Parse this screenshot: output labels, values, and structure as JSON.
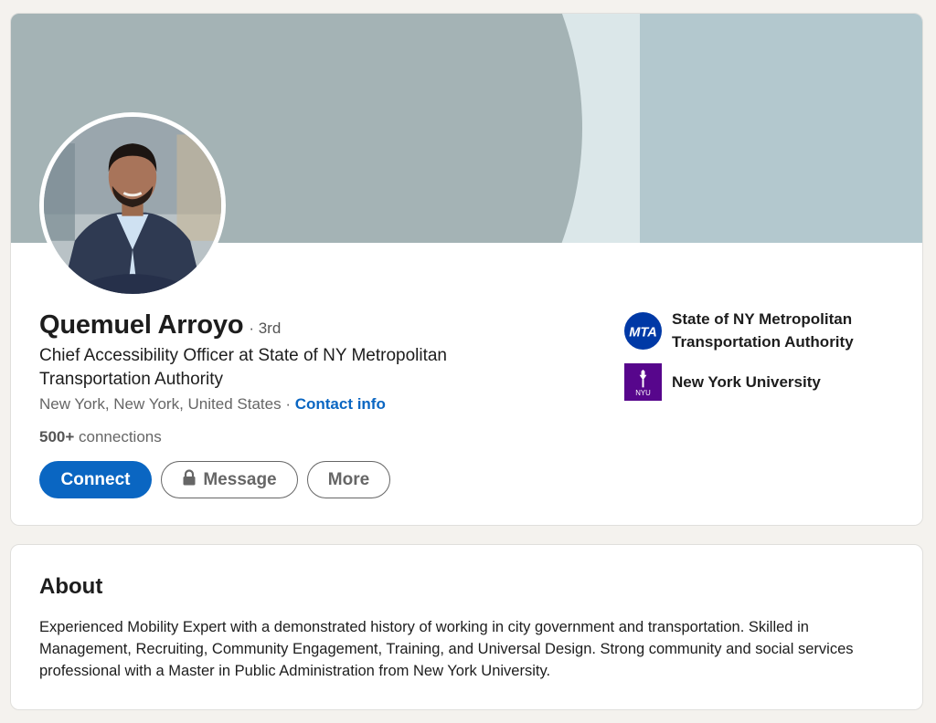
{
  "profile": {
    "name": "Quemuel Arroyo",
    "degree": "· 3rd",
    "headline": "Chief Accessibility Officer at State of NY Metropolitan Transportation Authority",
    "location": "New York, New York, United States",
    "separator": " · ",
    "contact_info_label": "Contact info",
    "connections_count": "500+",
    "connections_label": " connections"
  },
  "actions": {
    "connect_label": "Connect",
    "message_label": "Message",
    "more_label": "More"
  },
  "organizations": [
    {
      "name": "State of NY Metropolitan Transportation Authority",
      "logo_text": "MTA",
      "icon": "mta-logo-icon"
    },
    {
      "name": "New York University",
      "logo_text": "NYU",
      "icon": "nyu-logo-icon"
    }
  ],
  "about": {
    "title": "About",
    "text": "Experienced Mobility Expert with a demonstrated history of working in city government and transportation. Skilled in Management, Recruiting, Community Engagement, Training, and Universal Design. Strong community and social services professional with a Master in Public Administration from New York University."
  },
  "colors": {
    "primary": "#0a66c2",
    "page_background": "#f4f2ee",
    "mta_blue": "#0039a6",
    "nyu_purple": "#57068c"
  }
}
